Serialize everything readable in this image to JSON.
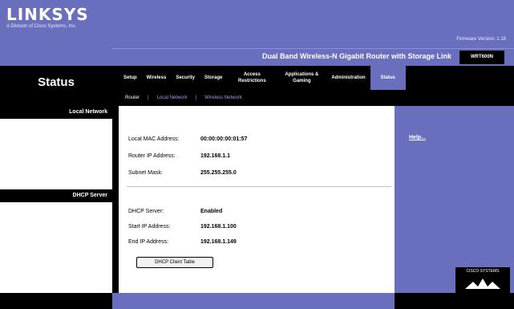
{
  "header": {
    "logo": "LINKSYS",
    "logo_sub": "A Division of Cisco Systems, Inc.",
    "firmware": "Firmware Version: 1.18",
    "product_name": "Dual Band Wireless-N Gigabit Router with Storage Link",
    "model": "WRT600N"
  },
  "page": {
    "title": "Status"
  },
  "tabs": [
    {
      "label": "Setup"
    },
    {
      "label": "Wireless"
    },
    {
      "label": "Security"
    },
    {
      "label": "Storage"
    },
    {
      "label": "Access Restrictions"
    },
    {
      "label": "Applications & Gaming"
    },
    {
      "label": "Administration"
    },
    {
      "label": "Status"
    }
  ],
  "subtabs": [
    {
      "label": "Router"
    },
    {
      "label": "Local Network"
    },
    {
      "label": "Wireless Network"
    }
  ],
  "left": {
    "local_network": "Local Network",
    "dhcp_server": "DHCP Server"
  },
  "local_network": {
    "mac_label": "Local MAC Address:",
    "mac_value": "00:00:00:00:01:57",
    "ip_label": "Router IP Address:",
    "ip_value": "192.168.1.1",
    "mask_label": "Subnet Mask:",
    "mask_value": "255.255.255.0"
  },
  "dhcp": {
    "server_label": "DHCP Server:",
    "server_value": "Enabled",
    "start_label": "Start IP Address:",
    "start_value": "192.168.1.100",
    "end_label": "End IP Address:",
    "end_value": "192.168.1.149",
    "button": "DHCP Client Table"
  },
  "help": "Help...",
  "footer": {
    "cisco": "CISCO SYSTEMS"
  },
  "colors": {
    "brand": "#6a6fbd",
    "black": "#000000",
    "white": "#ffffff"
  }
}
